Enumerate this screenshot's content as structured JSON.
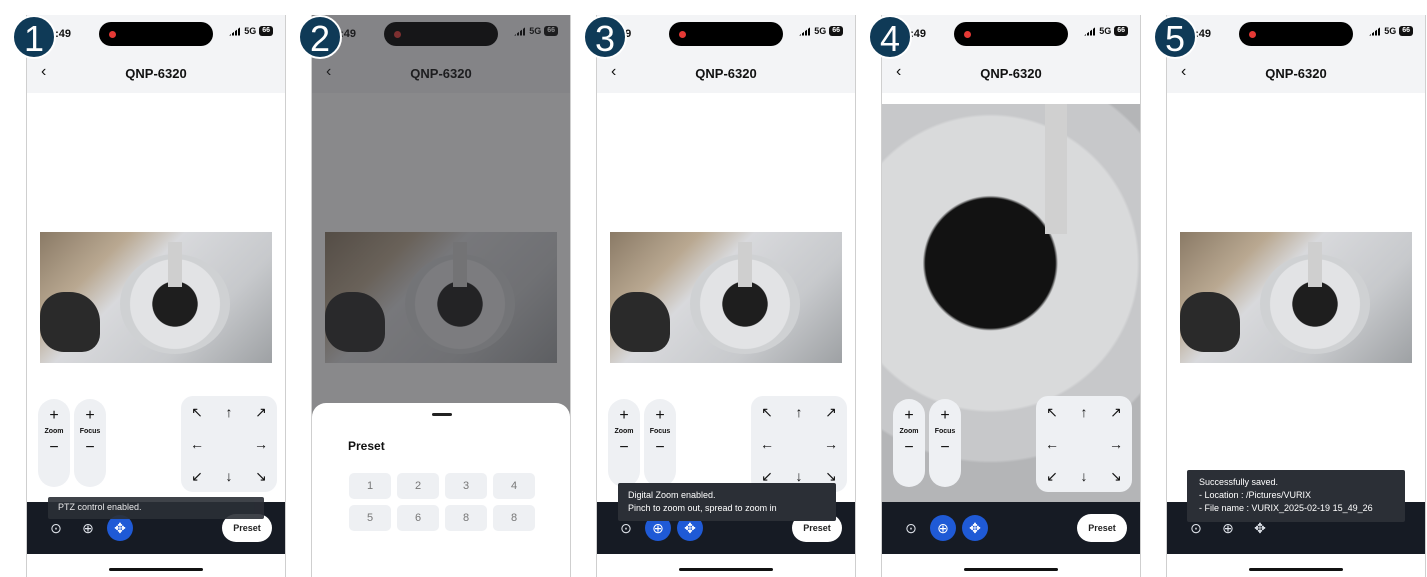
{
  "steps": [
    "1",
    "2",
    "3",
    "4",
    "5"
  ],
  "status": {
    "time": "3:49",
    "network": "5G",
    "battery": "66"
  },
  "panels_status_time": [
    "3:49",
    "3:49",
    "3:49",
    "3:49",
    "3:49"
  ],
  "panel3_status_time": "49",
  "nav": {
    "title": "QNP-6320"
  },
  "controls": {
    "zoom_label": "Zoom",
    "focus_label": "Focus",
    "plus": "+",
    "minus": "−",
    "arrows": {
      "ul": "↖",
      "up": "↑",
      "ur": "↗",
      "left": "←",
      "right": "→",
      "dl": "↙",
      "down": "↓",
      "dr": "↘"
    }
  },
  "toolbar": {
    "preset_label": "Preset",
    "camera_icon": "⊙",
    "zoom_icon": "⊕",
    "move_icon": "✥"
  },
  "toasts": {
    "ptz": "PTZ control enabled.",
    "digital_zoom_1": "Digital Zoom enabled.",
    "digital_zoom_2": "Pinch to zoom out, spread to zoom in",
    "saved_1": "Successfully saved.",
    "saved_2": "- Location : /Pictures/VURIX",
    "saved_3": "- File name : VURIX_2025-02-19 15_49_26"
  },
  "preset_sheet": {
    "title": "Preset",
    "items": [
      "1",
      "2",
      "3",
      "4",
      "5",
      "6",
      "8",
      "8"
    ]
  },
  "colors": {
    "accent": "#1f5ad6",
    "toolbar_bg": "#161b24",
    "badge": "#0f3a57"
  }
}
